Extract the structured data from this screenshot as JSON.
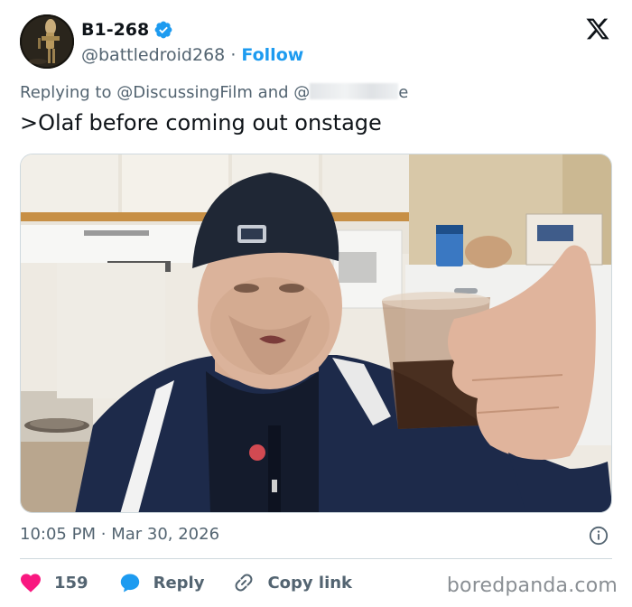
{
  "author": {
    "display_name": "B1-268",
    "handle": "@battledroid268",
    "separator": "·",
    "follow_label": "Follow"
  },
  "reply_context": {
    "prefix": "Replying to",
    "mention_1": "@DiscussingFilm",
    "conjunction": "and",
    "mention_2_start": "@",
    "mention_2_end": "e"
  },
  "tweet": {
    "text": ">Olaf before coming out onstage"
  },
  "meta": {
    "time": "10:05 PM",
    "separator": "·",
    "date": "Mar 30, 2026"
  },
  "actions": {
    "like_count": "159",
    "reply_label": "Reply",
    "copy_link_label": "Copy link"
  },
  "watermark": "boredpanda.com",
  "colors": {
    "accent": "#1d9bf0",
    "like": "#f91880",
    "reply_icon": "#1d9bf0",
    "secondary_text": "#536471"
  },
  "icons": [
    "verified-badge-icon",
    "x-logo-icon",
    "info-icon",
    "heart-icon",
    "reply-bubble-icon",
    "link-icon"
  ]
}
